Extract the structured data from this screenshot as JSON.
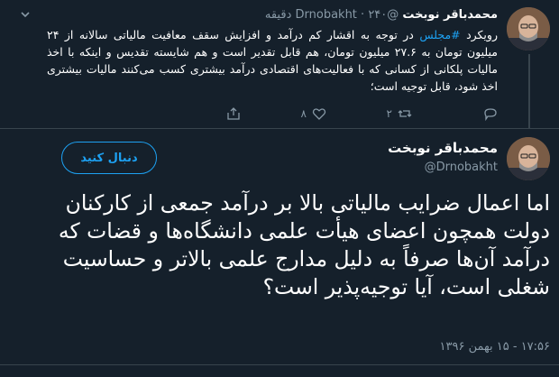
{
  "parent_tweet": {
    "display_name": "محمدباقر نوبخت",
    "handle": "@Drnobakht",
    "separator": "·",
    "time_ago": "۲۴۰ دقیقه",
    "text_before_hashtag": "رویکرد ",
    "hashtag": "#مجلس",
    "text_after_hashtag": " در توجه به اقشار کم درآمد و افزایش سقف معافیت مالیاتی سالانه از ۲۴ میلیون تومان به ۲۷.۶ میلیون تومان، هم قابل تقدیر است و هم شایسته تقدیس و اینکه با اخذ مالیات پلکانی از کسانی که با فعالیت‌های اقتصادی درآمد بیشتری کسب می‌کنند مالیات بیشتری اخذ شود، قابل توجیه است؛",
    "actions": {
      "reply_count": "",
      "retweet_count": "۲",
      "like_count": "۸"
    }
  },
  "main_tweet": {
    "display_name": "محمدباقر نوبخت",
    "handle": "@Drnobakht",
    "follow_label": "دنبال کنید",
    "text": "اما اعمال ضرایب مالیاتی بالا بر درآمد جمعی از کارکنان دولت همچون اعضای هیأت علمی دانشگاه‌ها و قضات که درآمد آن‌ها صرفاً به دلیل مدارج علمی بالاتر و حساسیت شغلی است، آیا توجیه‌پذیر است؟",
    "timestamp": "۱۷:۵۶ - ۱۵ بهمن ۱۳۹۶"
  },
  "colors": {
    "background": "#15202b",
    "accent": "#1da1f2",
    "muted": "#8899a6",
    "divider": "#38444d"
  },
  "icons": {
    "reply": "reply-icon",
    "retweet": "retweet-icon",
    "like": "heart-icon",
    "share": "share-icon",
    "menu": "chevron-down-icon"
  }
}
